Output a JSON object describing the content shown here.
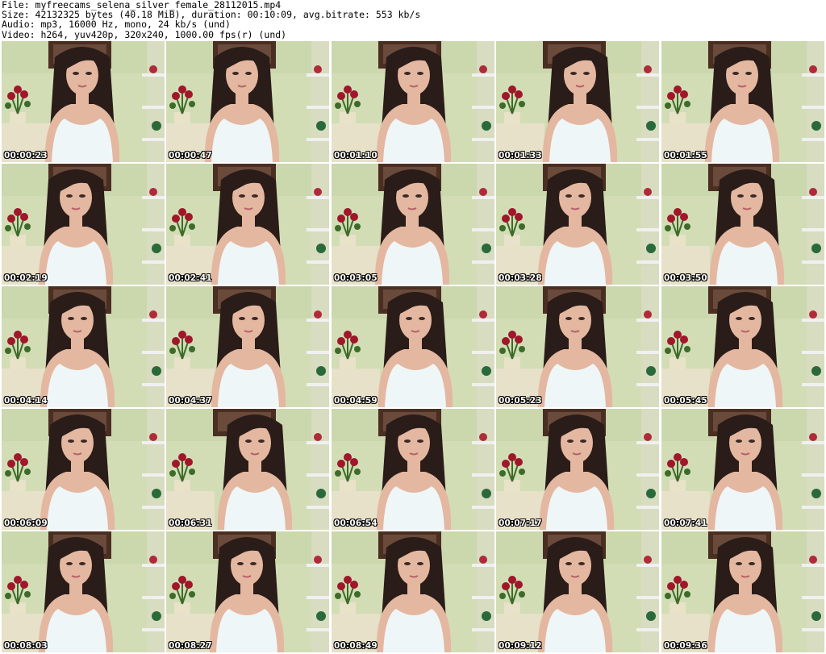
{
  "header": {
    "line1": "File: myfreecams_selena_silver_female_28112015.mp4",
    "line2": "Size: 42132325 bytes (40.18 MiB), duration: 00:10:09, avg.bitrate: 553 kb/s",
    "line3": "Audio: mp3, 16000 Hz, mono, 24 kb/s (und)",
    "line4": "Video: h264, yuv420p, 320x240, 1000.00 fps(r) (und)"
  },
  "thumbnails": [
    {
      "timestamp": "00:00:23"
    },
    {
      "timestamp": "00:00:47"
    },
    {
      "timestamp": "00:01:10"
    },
    {
      "timestamp": "00:01:33"
    },
    {
      "timestamp": "00:01:55"
    },
    {
      "timestamp": "00:02:19"
    },
    {
      "timestamp": "00:02:41"
    },
    {
      "timestamp": "00:03:05"
    },
    {
      "timestamp": "00:03:28"
    },
    {
      "timestamp": "00:03:50"
    },
    {
      "timestamp": "00:04:14"
    },
    {
      "timestamp": "00:04:37"
    },
    {
      "timestamp": "00:04:59"
    },
    {
      "timestamp": "00:05:23"
    },
    {
      "timestamp": "00:05:45"
    },
    {
      "timestamp": "00:06:09"
    },
    {
      "timestamp": "00:06:31"
    },
    {
      "timestamp": "00:06:54"
    },
    {
      "timestamp": "00:07:17"
    },
    {
      "timestamp": "00:07:41"
    },
    {
      "timestamp": "00:08:03"
    },
    {
      "timestamp": "00:08:27"
    },
    {
      "timestamp": "00:08:49"
    },
    {
      "timestamp": "00:09:12"
    },
    {
      "timestamp": "00:09:36"
    }
  ],
  "colors": {
    "wall": "#d2ddb5",
    "frame": "#4a2e22",
    "roses": "#a0162a",
    "leaves": "#3d6b2a",
    "pot": "#e8e2c8",
    "hair": "#2a1c18",
    "skin": "#e4b7a0",
    "top": "#eef6f8"
  }
}
